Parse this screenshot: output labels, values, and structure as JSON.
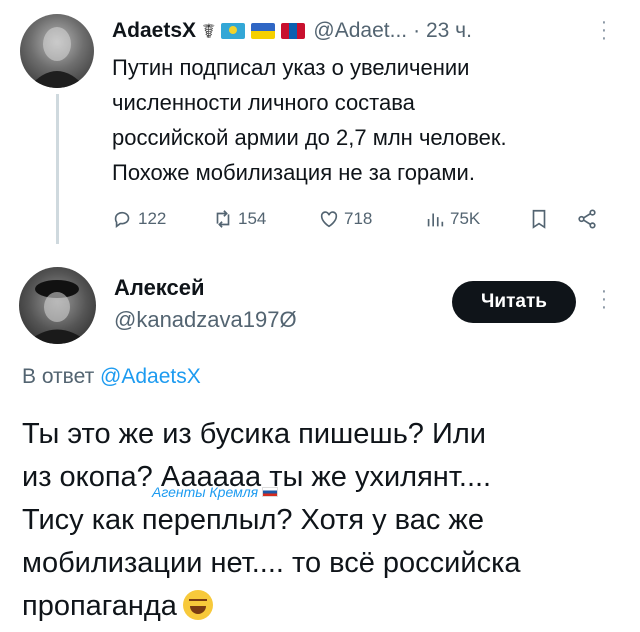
{
  "tweet1": {
    "avatar_icon": "user-avatar",
    "name": "AdaetsX",
    "symbol_glyph": "☤",
    "flags": [
      "flag-kazakhstan",
      "flag-ukraine",
      "flag-mongolia"
    ],
    "handle": "@Adaet...",
    "time": "· 23 ч.",
    "text": "Путин подписал указ о увеличении\nчисленности личного состава\nроссийской армии до 2,7 млн человек.\nПохоже мобилизация не за горами.",
    "actions": {
      "replies": "122",
      "retweets": "154",
      "likes": "718",
      "views": "75K"
    }
  },
  "tweet2": {
    "avatar_icon": "user-avatar",
    "name": "Алексей",
    "handle": "@kanadzava197Ø",
    "follow_label": "Читать",
    "reply_prefix": "В ответ",
    "reply_mention": "@AdaetsX",
    "text": "Ты это же из бусика пишешь? Или\nиз окопа? Аааааа ты же ухилянт....\nТису как переплыл? Хотя у вас же\nмобилизации нет.... то всё российска\nпропаганда",
    "emoji": "grinning-sweat-emoji",
    "watermark": "Агенты Кремля"
  },
  "colors": {
    "accent": "#1d9bf0",
    "text": "#0f1419",
    "muted": "#536471",
    "button": "#0f1419"
  }
}
